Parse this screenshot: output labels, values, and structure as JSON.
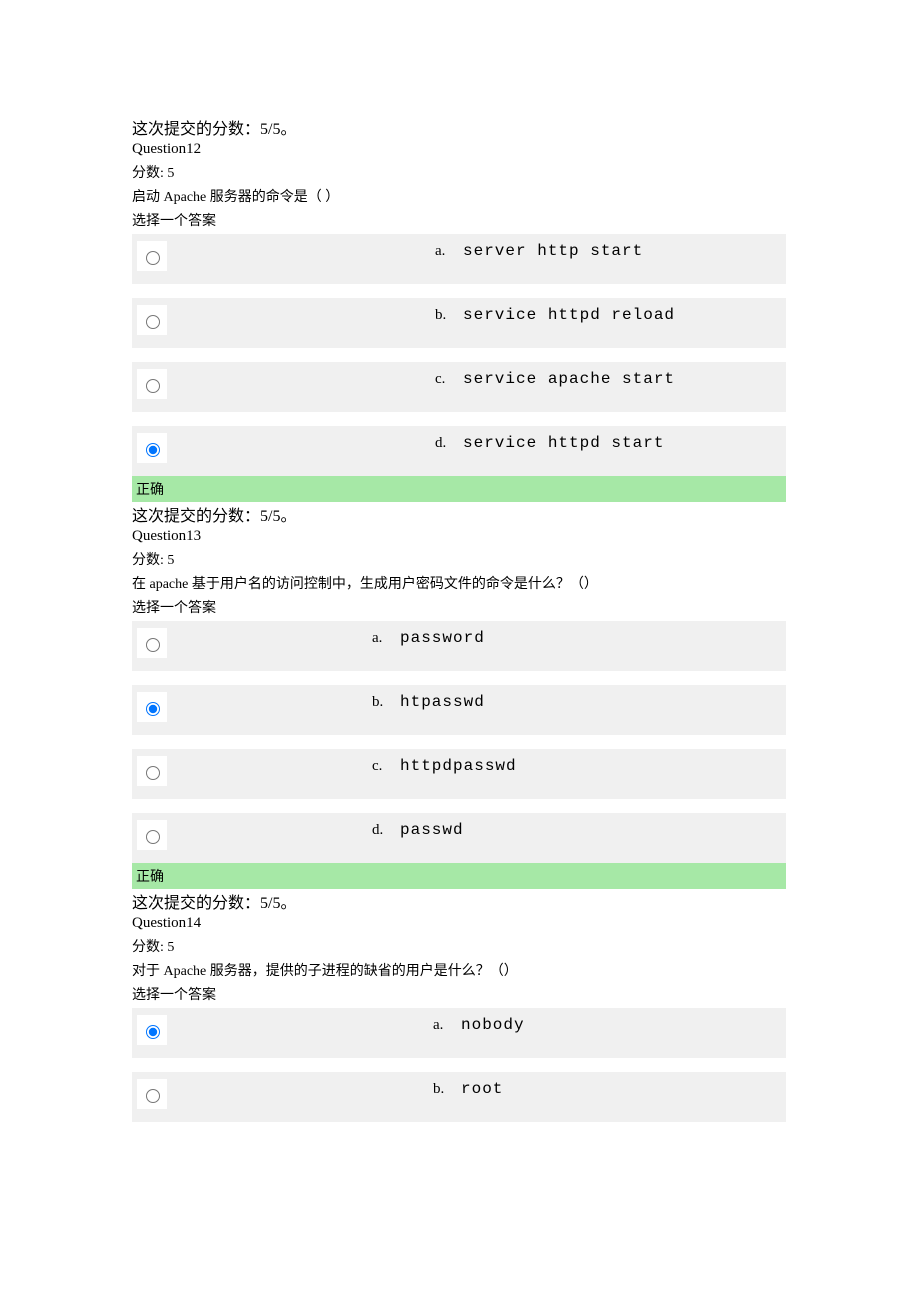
{
  "score_text": "这次提交的分数：5/5。",
  "q12": {
    "num": "Question12",
    "points": "分数: 5",
    "text": "启动 Apache 服务器的命令是（ ）",
    "hint": "选择一个答案",
    "a_l": "a.",
    "a_t": "server http start",
    "b_l": "b.",
    "b_t": "service httpd reload",
    "c_l": "c.",
    "c_t": "service apache start",
    "d_l": "d.",
    "d_t": "service httpd start",
    "correct": "正确"
  },
  "q13": {
    "num": "Question13",
    "points": "分数: 5",
    "text": "在 apache 基于用户名的访问控制中，生成用户密码文件的命令是什么？（）",
    "hint": "选择一个答案",
    "a_l": "a.",
    "a_t": "password",
    "b_l": "b.",
    "b_t": "htpasswd",
    "c_l": "c.",
    "c_t": "httpdpasswd",
    "d_l": "d.",
    "d_t": "passwd",
    "correct": "正确"
  },
  "q14": {
    "num": "Question14",
    "points": "分数: 5",
    "text": "对于 Apache 服务器，提供的子进程的缺省的用户是什么？（）",
    "hint": "选择一个答案",
    "a_l": "a.",
    "a_t": "nobody",
    "b_l": "b.",
    "b_t": "root"
  }
}
